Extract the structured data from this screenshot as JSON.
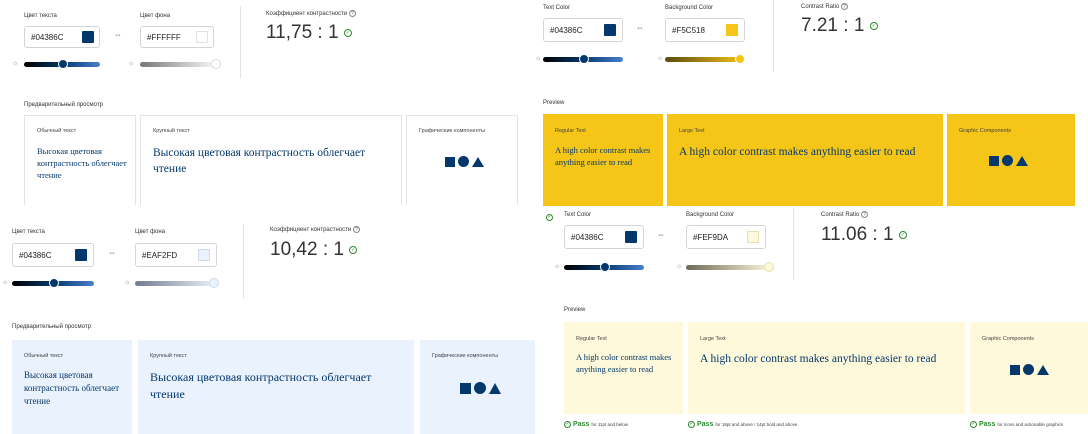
{
  "colors": {
    "text": "#04386C",
    "bg1": "#FFFFFF",
    "bg2": "#F5C518",
    "bg3": "#EAF2FD",
    "bg4": "#FEF9DA",
    "pass": "#2d8a2d"
  },
  "p1": {
    "text_label": "Цвет текста",
    "text_value": "#04386C",
    "bg_label": "Цвет фона",
    "bg_value": "#FFFFFF",
    "ratio_label": "Коэффициент контрастности",
    "ratio": "11,75 : 1",
    "preview_label": "Предварительный просмотр",
    "normal_label": "Обычный текст",
    "normal_text": "Высокая цветовая контрастность облегчает чтение",
    "large_label": "Крупный текст",
    "large_text": "Высокая цветовая контрастность облегчает чтение",
    "graphic_label": "Графические компоненты"
  },
  "p2": {
    "text_label": "Text Color",
    "text_value": "#04386C",
    "bg_label": "Background Color",
    "bg_value": "#F5C518",
    "ratio_label": "Contrast Ratio",
    "ratio": "7.21 : 1",
    "preview_label": "Preview",
    "normal_label": "Regular Text",
    "normal_text": "A high color contrast makes anything easier to read",
    "large_label": "Large Text",
    "large_text": "A high color contrast makes anything easier to read",
    "graphic_label": "Graphic Components"
  },
  "p3": {
    "text_label": "Цвет текста",
    "text_value": "#04386C",
    "bg_label": "Цвет фона",
    "bg_value": "#EAF2FD",
    "ratio_label": "Коэффициент контрастности",
    "ratio": "10,42 : 1",
    "preview_label": "Предварительный просмотр",
    "normal_label": "Обычный текст",
    "normal_text": "Высокая цветовая контрастность облегчает чтение",
    "large_label": "Крупный текст",
    "large_text": "Высокая цветовая контрастность облегчает чтение",
    "graphic_label": "Графические компоненты"
  },
  "p4": {
    "text_label": "Text Color",
    "text_value": "#04386C",
    "bg_label": "Background Color",
    "bg_value": "#FEF9DA",
    "ratio_label": "Contrast Ratio",
    "ratio": "11.06 : 1",
    "preview_label": "Preview",
    "normal_label": "Regular Text",
    "normal_text": "A high color contrast makes anything easier to read",
    "large_label": "Large Text",
    "large_text": "A high color contrast makes anything easier to read",
    "graphic_label": "Graphic Components",
    "pass_word": "Pass",
    "pass_normal": "for 11pt and below",
    "pass_large": "for 18pt and above / 14pt bold and above",
    "pass_graphic": "for icons and actionable graphics"
  }
}
